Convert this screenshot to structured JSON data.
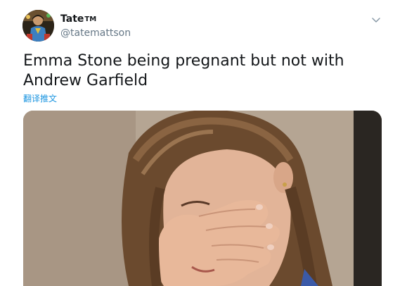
{
  "tweet": {
    "display_name": "Tate",
    "name_suffix": "TM",
    "handle": "@tatemattson",
    "text": "Emma Stone being pregnant but not with Andrew Garfield",
    "translate_label": "翻译推文",
    "more_icon": "chevron-down-icon",
    "media_icon": "photo"
  },
  "colors": {
    "text_primary": "#14171a",
    "text_secondary": "#657786",
    "link": "#1b95e0"
  }
}
